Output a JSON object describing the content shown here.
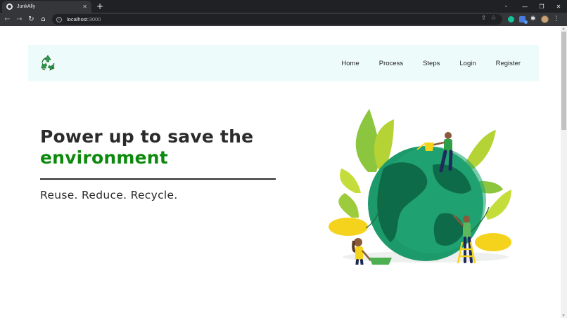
{
  "browser": {
    "tab_title": "JunkAlly",
    "tab_close": "✕",
    "new_tab": "+",
    "url_host": "localhost",
    "url_port": ":3000",
    "window_controls": [
      "⌄",
      "—",
      "❐",
      "✕"
    ]
  },
  "navbar": {
    "logo_icon": "recycle-icon",
    "items": [
      "Home",
      "Process",
      "Steps",
      "Login",
      "Register"
    ]
  },
  "hero": {
    "title_line1": "Power up to save the",
    "title_line2": "environment",
    "subtitle": "Reuse. Reduce. Recycle."
  },
  "colors": {
    "accent_green": "#0d8a0d",
    "navbar_bg": "#eefbfb",
    "text_dark": "#2b2b2b"
  },
  "illustration": "earth-with-people-and-plants"
}
